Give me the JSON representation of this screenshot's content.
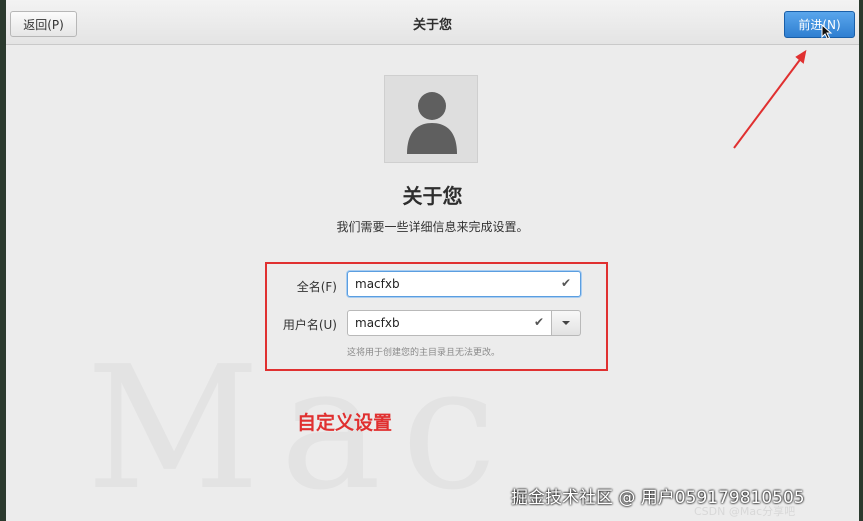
{
  "header": {
    "back_label": "返回(P)",
    "title": "关于您",
    "next_label": "前进(N)"
  },
  "main": {
    "heading": "关于您",
    "subtitle": "我们需要一些详细信息来完成设置。",
    "fullname_label": "全名(F)",
    "fullname_value": "macfxb",
    "username_label": "用户名(U)",
    "username_value": "macfxb",
    "username_hint": "这将用于创建您的主目录且无法更改。"
  },
  "annotation": {
    "text": "自定义设置",
    "color": "#e03030"
  },
  "watermark": {
    "primary": "掘金技术社区 @ 用户059179810505",
    "secondary": "CSDN @Mac分享吧"
  },
  "icons": {
    "avatar": "user-avatar-icon",
    "check": "checkmark-icon",
    "dropdown": "chevron-down-icon"
  },
  "colors": {
    "accent": "#2f7fd1",
    "annotation_red": "#e03030"
  }
}
